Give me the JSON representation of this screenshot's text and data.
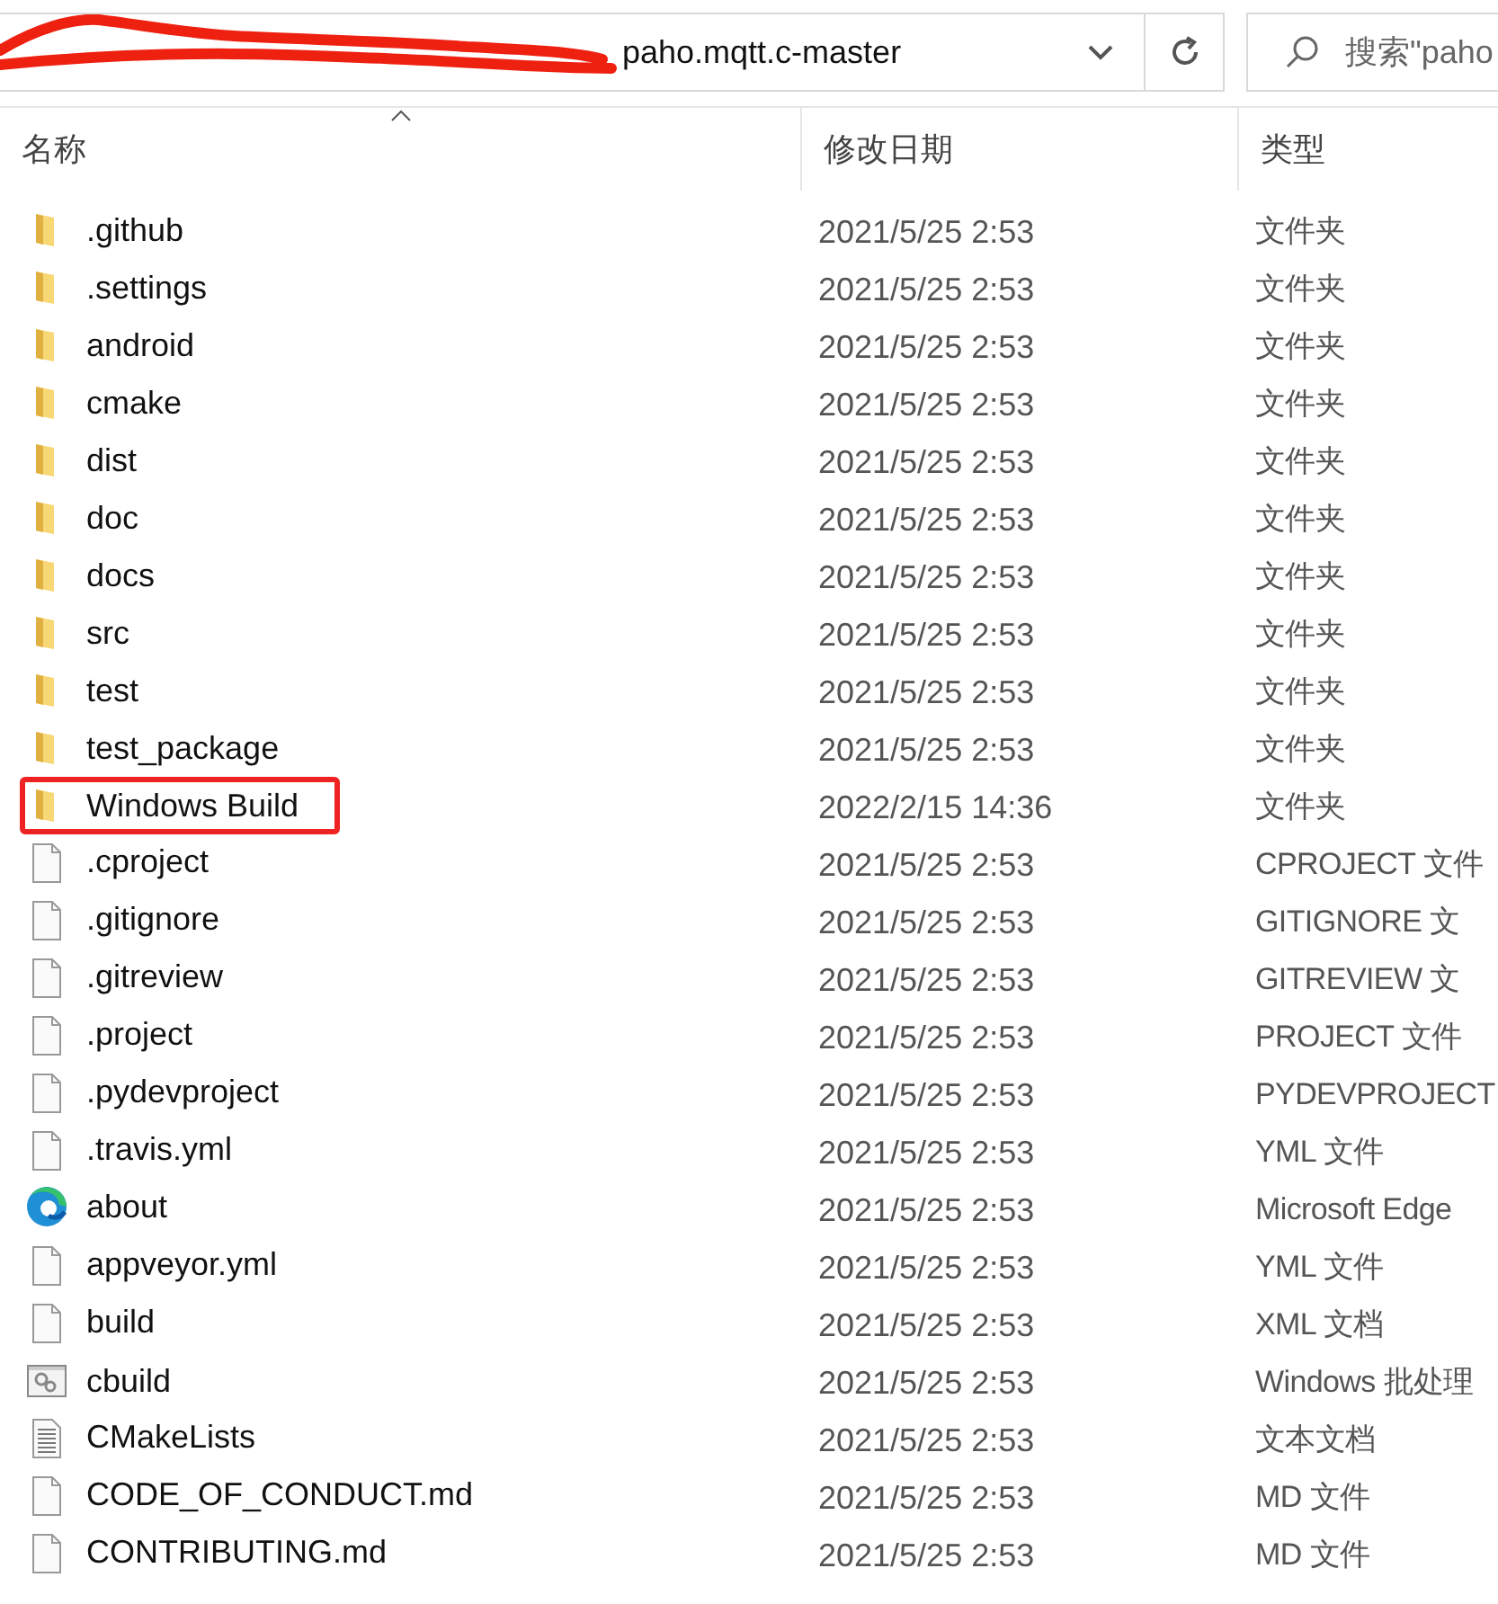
{
  "address_bar": {
    "path_current": "paho.mqtt.c-master",
    "redacted": true
  },
  "search": {
    "placeholder": "搜索\"paho"
  },
  "columns": [
    {
      "label": "名称",
      "sorted": true
    },
    {
      "label": "修改日期",
      "sorted": false
    },
    {
      "label": "类型",
      "sorted": false
    }
  ],
  "files": [
    {
      "kind": "folder",
      "name": ".github",
      "date": "2021/5/25 2:53",
      "type": "文件夹",
      "highlighted": false
    },
    {
      "kind": "folder",
      "name": ".settings",
      "date": "2021/5/25 2:53",
      "type": "文件夹",
      "highlighted": false
    },
    {
      "kind": "folder",
      "name": "android",
      "date": "2021/5/25 2:53",
      "type": "文件夹",
      "highlighted": false
    },
    {
      "kind": "folder",
      "name": "cmake",
      "date": "2021/5/25 2:53",
      "type": "文件夹",
      "highlighted": false
    },
    {
      "kind": "folder",
      "name": "dist",
      "date": "2021/5/25 2:53",
      "type": "文件夹",
      "highlighted": false
    },
    {
      "kind": "folder",
      "name": "doc",
      "date": "2021/5/25 2:53",
      "type": "文件夹",
      "highlighted": false
    },
    {
      "kind": "folder",
      "name": "docs",
      "date": "2021/5/25 2:53",
      "type": "文件夹",
      "highlighted": false
    },
    {
      "kind": "folder",
      "name": "src",
      "date": "2021/5/25 2:53",
      "type": "文件夹",
      "highlighted": false
    },
    {
      "kind": "folder",
      "name": "test",
      "date": "2021/5/25 2:53",
      "type": "文件夹",
      "highlighted": false
    },
    {
      "kind": "folder",
      "name": "test_package",
      "date": "2021/5/25 2:53",
      "type": "文件夹",
      "highlighted": false
    },
    {
      "kind": "folder",
      "name": "Windows Build",
      "date": "2022/2/15 14:36",
      "type": "文件夹",
      "highlighted": true
    },
    {
      "kind": "file",
      "name": ".cproject",
      "date": "2021/5/25 2:53",
      "type": "CPROJECT 文件",
      "highlighted": false
    },
    {
      "kind": "file",
      "name": ".gitignore",
      "date": "2021/5/25 2:53",
      "type": "GITIGNORE 文",
      "highlighted": false
    },
    {
      "kind": "file",
      "name": ".gitreview",
      "date": "2021/5/25 2:53",
      "type": "GITREVIEW 文",
      "highlighted": false
    },
    {
      "kind": "file",
      "name": ".project",
      "date": "2021/5/25 2:53",
      "type": "PROJECT 文件",
      "highlighted": false
    },
    {
      "kind": "file",
      "name": ".pydevproject",
      "date": "2021/5/25 2:53",
      "type": "PYDEVPROJECT",
      "highlighted": false
    },
    {
      "kind": "file",
      "name": ".travis.yml",
      "date": "2021/5/25 2:53",
      "type": "YML 文件",
      "highlighted": false
    },
    {
      "kind": "browser",
      "name": "about",
      "date": "2021/5/25 2:53",
      "type": "Microsoft Edge",
      "highlighted": false
    },
    {
      "kind": "file",
      "name": "appveyor.yml",
      "date": "2021/5/25 2:53",
      "type": "YML 文件",
      "highlighted": false
    },
    {
      "kind": "file",
      "name": "build",
      "date": "2021/5/25 2:53",
      "type": "XML 文档",
      "highlighted": false
    },
    {
      "kind": "batch",
      "name": "cbuild",
      "date": "2021/5/25 2:53",
      "type": "Windows 批处理",
      "highlighted": false
    },
    {
      "kind": "text",
      "name": "CMakeLists",
      "date": "2021/5/25 2:53",
      "type": "文本文档",
      "highlighted": false
    },
    {
      "kind": "file",
      "name": "CODE_OF_CONDUCT.md",
      "date": "2021/5/25 2:53",
      "type": "MD 文件",
      "highlighted": false
    },
    {
      "kind": "file",
      "name": "CONTRIBUTING.md",
      "date": "2021/5/25 2:53",
      "type": "MD 文件",
      "highlighted": false
    }
  ]
}
